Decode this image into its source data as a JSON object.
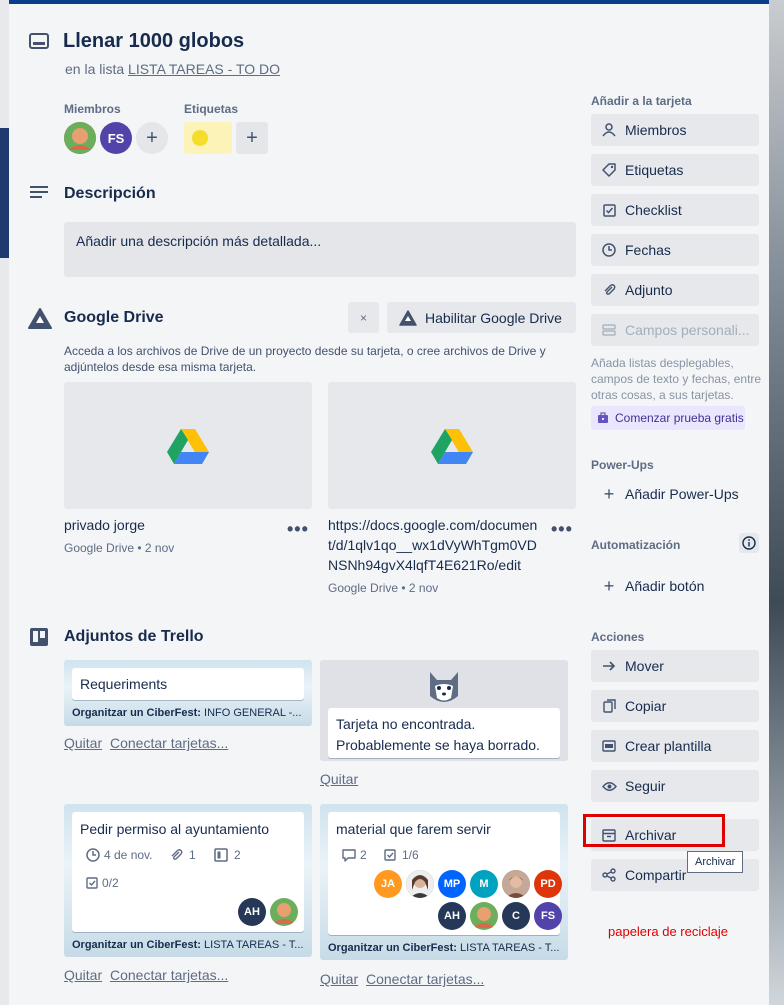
{
  "card": {
    "title": "Llenar 1000 globos",
    "in_list_prefix": "en la lista",
    "list_name": "LISTA TAREAS - TO DO"
  },
  "members": {
    "label": "Miembros",
    "avatars": [
      {
        "initials": "",
        "color": "#d9694a"
      },
      {
        "initials": "FS",
        "color": "#5243aa"
      }
    ]
  },
  "labels": {
    "label": "Etiquetas",
    "chip_color": "#f5dd29"
  },
  "description": {
    "heading": "Descripción",
    "placeholder": "Añadir una descripción más detallada..."
  },
  "google_drive": {
    "heading": "Google Drive",
    "close_glyph": "×",
    "enable_button": "Habilitar Google Drive",
    "text": "Acceda a los archivos de Drive de un proyecto desde su tarjeta, o cree archivos de Drive y adjúntelos desde esa misma tarjeta.",
    "files": [
      {
        "name": "privado jorge",
        "meta": "Google Drive • 2 nov"
      },
      {
        "name": "https://docs.google.com/document/d/1qlv1qo__wx1dVyWhTgm0VDNSNh94gvX4lqfT4E621Ro/edit",
        "meta": "Google Drive • 2 nov"
      }
    ],
    "menu_glyph": "•••"
  },
  "trello_attachments": {
    "heading": "Adjuntos de Trello",
    "remove_link": "Quitar",
    "connect_link": "Conectar tarjetas...",
    "cards": [
      {
        "title": "Requeriments",
        "board": "Organitzar un CiberFest:",
        "list": "INFO GENERAL -..."
      },
      {
        "title": "Tarjeta no encontrada. Probablemente se haya borrado."
      },
      {
        "title": "Pedir permiso al ayuntamiento",
        "date": "4 de nov.",
        "attachments": "1",
        "cards": "2",
        "checklist": "0/2",
        "board": "Organitzar un CiberFest:",
        "list": "LISTA TAREAS - T..."
      },
      {
        "title": "material que farem servir",
        "comments": "2",
        "checklist": "1/6",
        "board": "Organitzar un CiberFest:",
        "list": "LISTA TAREAS - T..."
      }
    ],
    "avatars_card3": [
      {
        "initials": "AH",
        "color": "#253858"
      },
      {
        "initials": "",
        "color": "#d9694a"
      }
    ],
    "avatars_card4": [
      {
        "initials": "JA",
        "color": "#ff991f"
      },
      {
        "initials": "",
        "color": "#8a6a5c"
      },
      {
        "initials": "MP",
        "color": "#0065ff"
      },
      {
        "initials": "M",
        "color": "#00a3bf"
      },
      {
        "initials": "",
        "color": "#b57a6a"
      },
      {
        "initials": "PD",
        "color": "#de350b"
      },
      {
        "initials": "AH",
        "color": "#253858"
      },
      {
        "initials": "",
        "color": "#d9694a"
      },
      {
        "initials": "C",
        "color": "#253858"
      },
      {
        "initials": "FS",
        "color": "#5243aa"
      }
    ]
  },
  "sidebar": {
    "add_heading": "Añadir a la tarjeta",
    "add_items": [
      "Miembros",
      "Etiquetas",
      "Checklist",
      "Fechas",
      "Adjunto",
      "Campos personali..."
    ],
    "custom_fields_hint": "Añada listas desplegables, campos de texto y fechas, entre otras cosas, a sus tarjetas.",
    "trial_button": "Comenzar prueba gratis",
    "powerups_heading": "Power-Ups",
    "add_powerups": "Añadir Power-Ups",
    "automation_heading": "Automatización",
    "add_button": "Añadir botón",
    "actions_heading": "Acciones",
    "action_items": [
      "Mover",
      "Copiar",
      "Crear plantilla",
      "Seguir",
      "Archivar",
      "Compartir"
    ]
  },
  "tooltip": "Archivar",
  "annotation": {
    "text": "papelera de reciclaje",
    "highlight_color": "#e00000"
  }
}
